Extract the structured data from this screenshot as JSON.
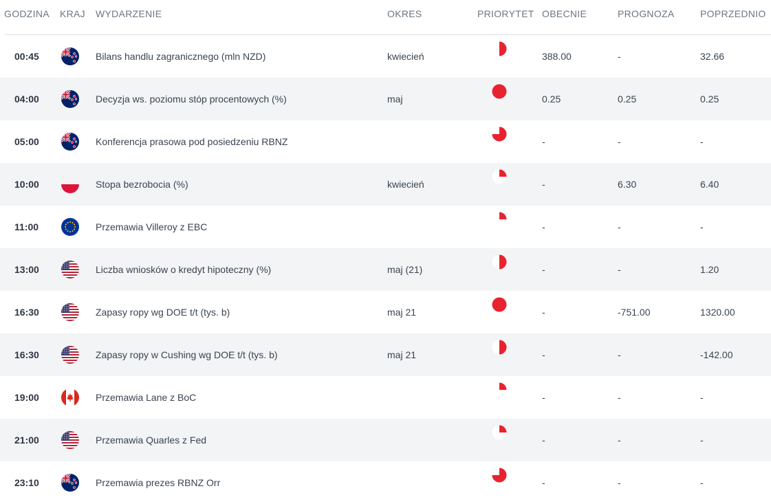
{
  "columns": {
    "time": "GODZINA",
    "country": "KRAJ",
    "event": "WYDARZENIE",
    "period": "OKRES",
    "priority": "PRIORYTET",
    "actual": "OBECNIE",
    "forecast": "PROGNOZA",
    "previous": "POPRZEDNIO"
  },
  "colors": {
    "priority_red": "#e8232f",
    "row_alt_bg": "#f2f4f6"
  },
  "rows": [
    {
      "time": "00:45",
      "flag": "new-zealand",
      "event": "Bilans handlu zagranicznego (mln NZD)",
      "period": "kwiecień",
      "priority": 0.5,
      "actual": "388.00",
      "forecast": "-",
      "previous": "32.66"
    },
    {
      "time": "04:00",
      "flag": "new-zealand",
      "event": "Decyzja ws. poziomu stóp procentowych (%)",
      "period": "maj",
      "priority": 1.0,
      "actual": "0.25",
      "forecast": "0.25",
      "previous": "0.25"
    },
    {
      "time": "05:00",
      "flag": "new-zealand",
      "event": "Konferencja prasowa pod posiedzeniu RBNZ",
      "period": "",
      "priority": 0.75,
      "actual": "-",
      "forecast": "-",
      "previous": "-"
    },
    {
      "time": "10:00",
      "flag": "poland",
      "event": "Stopa bezrobocia (%)",
      "period": "kwiecień",
      "priority": 0.25,
      "actual": "-",
      "forecast": "6.30",
      "previous": "6.40"
    },
    {
      "time": "11:00",
      "flag": "european-union",
      "event": "Przemawia Villeroy z EBC",
      "period": "",
      "priority": 0.25,
      "actual": "-",
      "forecast": "-",
      "previous": "-"
    },
    {
      "time": "13:00",
      "flag": "united-states",
      "event": "Liczba wniosków o kredyt hipoteczny (%)",
      "period": "maj (21)",
      "priority": 0.5,
      "actual": "-",
      "forecast": "-",
      "previous": "1.20"
    },
    {
      "time": "16:30",
      "flag": "united-states",
      "event": "Zapasy ropy wg DOE t/t (tys. b)",
      "period": "maj 21",
      "priority": 1.0,
      "actual": "-",
      "forecast": "-751.00",
      "previous": "1320.00"
    },
    {
      "time": "16:30",
      "flag": "united-states",
      "event": "Zapasy ropy w Cushing wg DOE t/t (tys. b)",
      "period": "maj 21",
      "priority": 0.5,
      "actual": "-",
      "forecast": "-",
      "previous": "-142.00"
    },
    {
      "time": "19:00",
      "flag": "canada",
      "event": "Przemawia Lane z BoC",
      "period": "",
      "priority": 0.25,
      "actual": "-",
      "forecast": "-",
      "previous": "-"
    },
    {
      "time": "21:00",
      "flag": "united-states",
      "event": "Przemawia Quarles z Fed",
      "period": "",
      "priority": 0.25,
      "actual": "-",
      "forecast": "-",
      "previous": "-"
    },
    {
      "time": "23:10",
      "flag": "new-zealand",
      "event": "Przemawia prezes RBNZ Orr",
      "period": "",
      "priority": 0.75,
      "actual": "-",
      "forecast": "-",
      "previous": "-"
    }
  ]
}
